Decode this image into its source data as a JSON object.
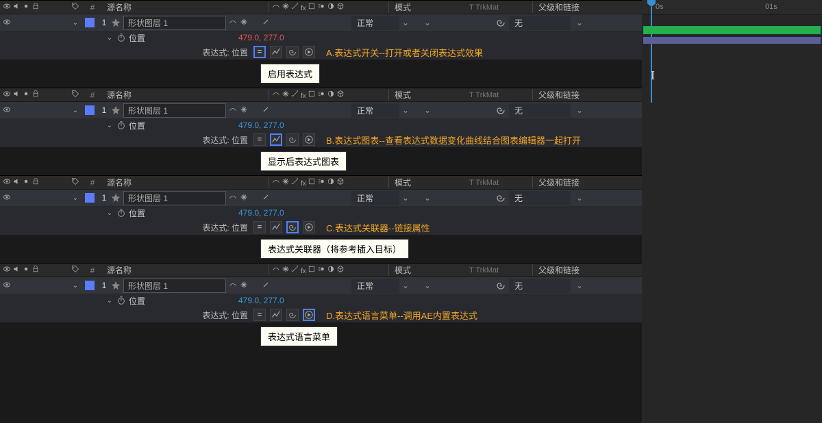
{
  "columns": {
    "source_name": "源名称",
    "mode": "模式",
    "trkmat": "T  TrkMat",
    "parent": "父级和链接",
    "hash": "#"
  },
  "layer": {
    "num": "1",
    "name": "形状图层 1",
    "position_label": "位置",
    "expr_label": "表达式: 位置",
    "mode_value": "正常",
    "parent_value": "无"
  },
  "pos_values": {
    "x": "479.0",
    "y": "277.0"
  },
  "timeline": {
    "t0": "0s",
    "t1": "01s"
  },
  "panels": [
    {
      "annot": "A.表达式开关--打开或者关闭表达式效果",
      "tooltip": "启用表达式",
      "hl": 0,
      "val_color": "red"
    },
    {
      "annot": "B.表达式图表--查看表达式数据变化曲线结合图表编辑器一起打开",
      "tooltip": "显示后表达式图表",
      "hl": 1,
      "val_color": "blue"
    },
    {
      "annot": "C.表达式关联器--链接属性",
      "tooltip": "表达式关联器（将参考插入目标）",
      "hl": 2,
      "val_color": "blue"
    },
    {
      "annot": "D.表达式语言菜单--调用AE内置表达式",
      "tooltip": "表达式语言菜单",
      "hl": 3,
      "val_color": "blue"
    }
  ]
}
